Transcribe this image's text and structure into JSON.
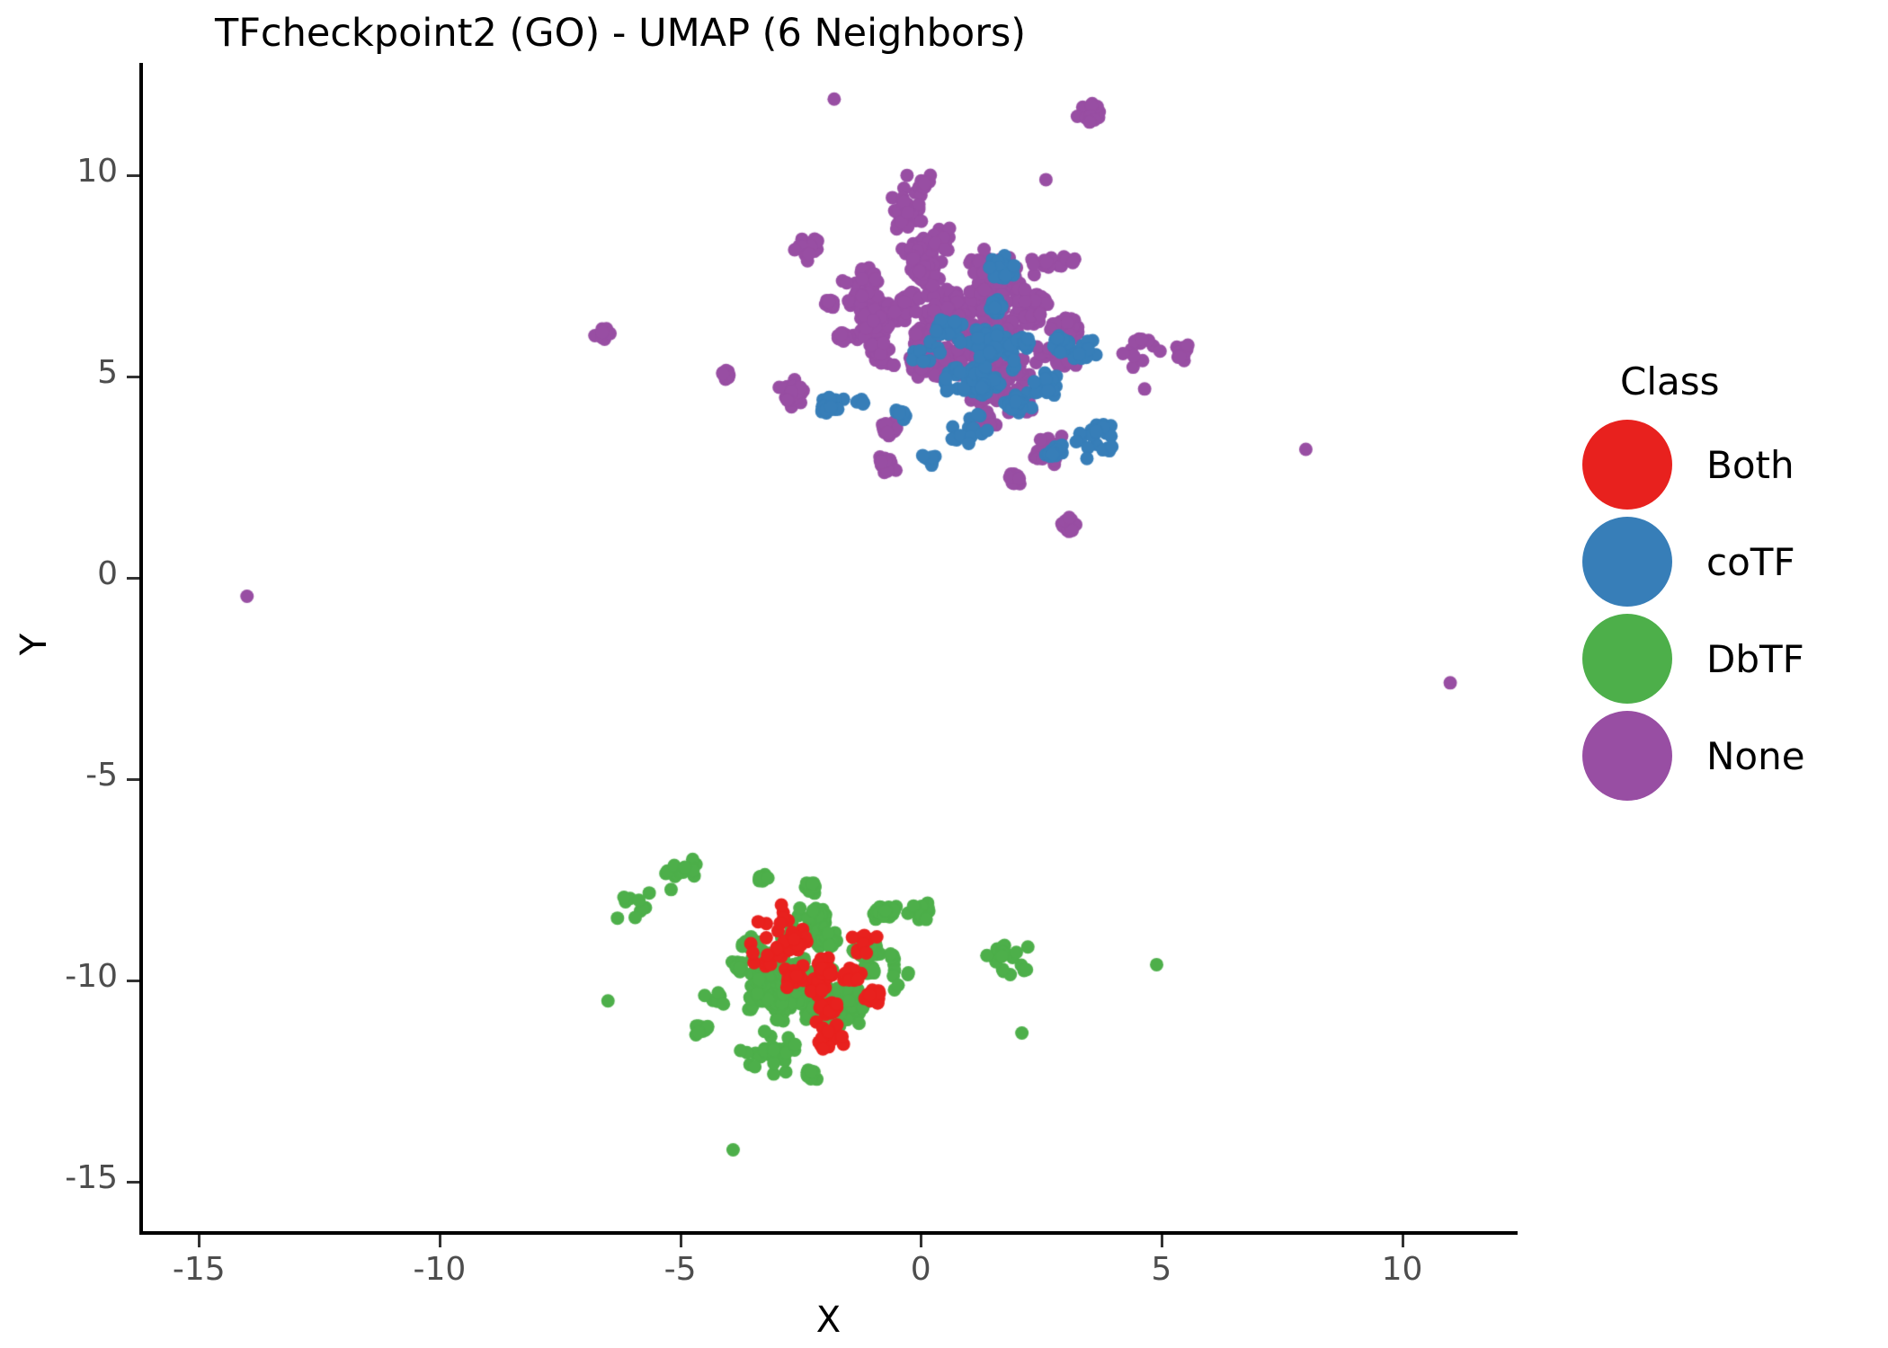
{
  "chart_data": {
    "type": "scatter",
    "title": "TFcheckpoint2 (GO) - UMAP (6 Neighbors)",
    "xlabel": "X",
    "ylabel": "Y",
    "xlim": [
      -16.2,
      12.4
    ],
    "ylim": [
      -16.4,
      12.8
    ],
    "xticks": [
      -15,
      -10,
      -5,
      0,
      5,
      10
    ],
    "xtick_labels": [
      "-15",
      "-10",
      "-5",
      "0",
      "5",
      "10"
    ],
    "yticks": [
      -15,
      -10,
      -5,
      0,
      5,
      10
    ],
    "ytick_labels": [
      "-15",
      "-10",
      "-5",
      "0",
      "5",
      "10"
    ],
    "grid": false,
    "legend_position": "right",
    "legend_title": "Class",
    "point_size": 9,
    "series": [
      {
        "name": "Both",
        "color": "#E8211E",
        "n_points": 170,
        "cluster": {
          "cx": -2.2,
          "cy": -9.7,
          "sx": 0.95,
          "sy": 0.75,
          "rot": -0.45
        },
        "description": "Red points concentrated in the lower cluster core near (-2.2, -9.7)"
      },
      {
        "name": "coTF",
        "color": "#377EB8",
        "n_points": 420,
        "cluster": {
          "cx": 1.2,
          "cy": 5.1,
          "sx": 1.15,
          "sy": 1.25,
          "rot": 0.35
        },
        "description": "Blue points in the upper cluster, offset toward lower-right of the purple mass"
      },
      {
        "name": "DbTF",
        "color": "#4DAF4A",
        "n_points": 720,
        "cluster": {
          "cx": -2.35,
          "cy": -9.9,
          "sx": 1.35,
          "sy": 1.15,
          "rot": -0.5
        },
        "description": "Green points dominate the lower cluster with filament arms to lower right"
      },
      {
        "name": "None",
        "color": "#984EA3",
        "n_points": 1250,
        "cluster": {
          "cx": 1.0,
          "cy": 6.1,
          "sx": 1.45,
          "sy": 1.6,
          "rot": 0.2
        },
        "description": "Purple points dominate the upper cluster, the largest group"
      }
    ],
    "outliers": [
      {
        "x": -14.0,
        "y": -0.45,
        "class": "None"
      },
      {
        "x": 8.0,
        "y": 3.2,
        "class": "None"
      },
      {
        "x": 11.0,
        "y": -2.6,
        "class": "None"
      },
      {
        "x": -1.8,
        "y": 11.9,
        "class": "None"
      },
      {
        "x": 2.6,
        "y": 9.9,
        "class": "None"
      },
      {
        "x": 4.65,
        "y": 4.7,
        "class": "None"
      },
      {
        "x": -6.5,
        "y": -10.5,
        "class": "DbTF"
      },
      {
        "x": 4.9,
        "y": -9.6,
        "class": "DbTF"
      },
      {
        "x": 2.1,
        "y": -11.3,
        "class": "DbTF"
      },
      {
        "x": -3.9,
        "y": -14.2,
        "class": "DbTF"
      }
    ],
    "notes": "Two well-separated UMAP clusters: an upper cluster (y approx 2 to 12) composed of None (purple) and coTF (blue) with a handful of DbTF points, and a lower cluster (y approx -5 to -15) composed of DbTF (green) and Both (red) with a few stray None/coTF points."
  },
  "title": {
    "text": "TFcheckpoint2 (GO) - UMAP (6 Neighbors)"
  },
  "axes": {
    "x_title": "X",
    "y_title": "Y",
    "x_ticks": [
      {
        "label": "-15",
        "value": -15
      },
      {
        "label": "-10",
        "value": -10
      },
      {
        "label": "-5",
        "value": -5
      },
      {
        "label": "0",
        "value": 0
      },
      {
        "label": "5",
        "value": 5
      },
      {
        "label": "10",
        "value": 10
      }
    ],
    "y_ticks": [
      {
        "label": "10",
        "value": 10
      },
      {
        "label": "5",
        "value": 5
      },
      {
        "label": "0",
        "value": 0
      },
      {
        "label": "-5",
        "value": -5
      },
      {
        "label": "-10",
        "value": -10
      },
      {
        "label": "-15",
        "value": -15
      }
    ]
  },
  "legend": {
    "title": "Class",
    "items": [
      {
        "label": "Both",
        "color": "#E8211E"
      },
      {
        "label": "coTF",
        "color": "#377EB8"
      },
      {
        "label": "DbTF",
        "color": "#4DAF4A"
      },
      {
        "label": "None",
        "color": "#984EA3"
      }
    ]
  }
}
